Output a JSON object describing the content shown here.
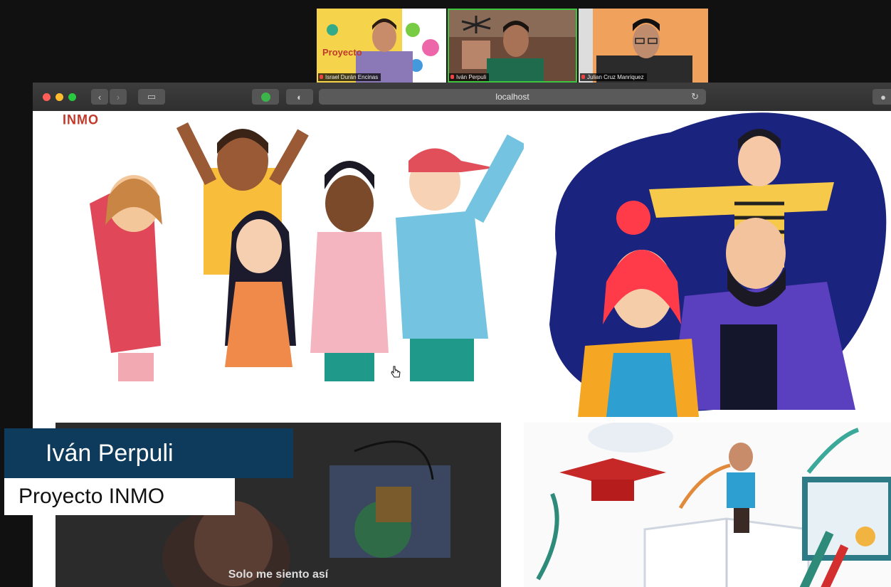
{
  "call": {
    "participants": [
      {
        "name": "Israel Durán Encinas"
      },
      {
        "name": "Iván Perpuli"
      },
      {
        "name": "Julian Cruz Manriquez"
      }
    ],
    "slide_text": "Proyecto"
  },
  "browser": {
    "url": "localhost",
    "traffic_lights": {
      "close": "#ff5f57",
      "minimize": "#febc2e",
      "maximize": "#28c840"
    }
  },
  "page": {
    "brand": "INMO",
    "video_caption": "Solo me siento así"
  },
  "lower_third": {
    "name": "Iván Perpuli",
    "subtitle": "Proyecto INMO"
  }
}
